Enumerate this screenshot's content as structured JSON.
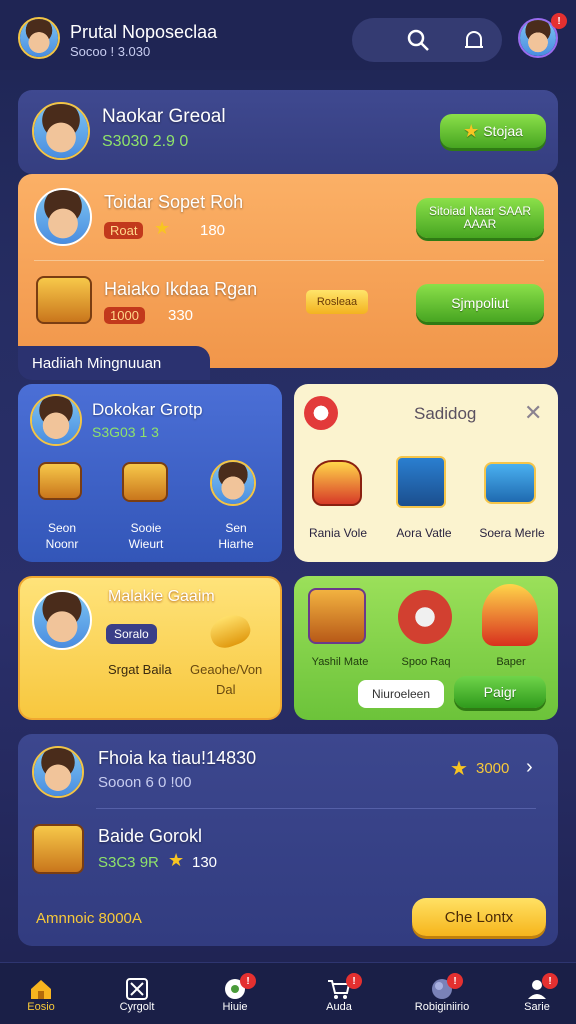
{
  "header": {
    "title": "Prutal Noposeclaa",
    "subtitle": "Socoo ! 3.030"
  },
  "profile_card": {
    "name": "Naokar Greoal",
    "stats": "S3030 2.9 0",
    "button": "Stojaa"
  },
  "orange_panel": {
    "row1": {
      "title": "Toidar Sopet Roh",
      "tag": "Roat",
      "value": "180",
      "button": "Sitoiad Naar SAAR AAAR"
    },
    "row2": {
      "title": "Haiako Ikdaa Rgan",
      "tag": "1000",
      "value": "330",
      "badge": "Rosleaa",
      "button": "Sjmpoliut"
    },
    "section_label": "Hadiiah Mingnuuan"
  },
  "blue_card": {
    "title": "Dokokar Grotp",
    "stats": "S3G03 1 3",
    "items": [
      {
        "line1": "Seon",
        "line2": "Noonr"
      },
      {
        "line1": "Sooie",
        "line2": "Wieurt"
      },
      {
        "line1": "Sen",
        "line2": "Hiarhe"
      }
    ]
  },
  "cream_card": {
    "title": "Sadidog",
    "items": [
      {
        "label": "Rania Vole"
      },
      {
        "label": "Aora Vatle"
      },
      {
        "label": "Soera Merle"
      }
    ]
  },
  "yellow_card": {
    "title": "Malakie Gaaim",
    "pill": "Soralo",
    "line1": "Srgat Baila",
    "line2a": "Geaohe/Von",
    "line2b": "Dal"
  },
  "green_card": {
    "items": [
      {
        "label": "Yashil Mate"
      },
      {
        "label": "Spoo Raq"
      },
      {
        "label": "Baper"
      }
    ],
    "button_secondary": "Niuroeleen",
    "button_primary": "Paigr"
  },
  "bottom_card": {
    "row1": {
      "title": "Fhoia ka tiau!14830",
      "sub": "Sooon 6 0 !00",
      "amount": "3000"
    },
    "row2": {
      "title": "Baide Gorokl",
      "sub": "S3C3 9R",
      "value": "130"
    },
    "footer_label": "Amnnoic 8000A",
    "footer_button": "Che Lontx"
  },
  "bottom_nav": [
    {
      "label": "Eosio",
      "icon": "home-icon"
    },
    {
      "label": "Cyrgolt",
      "icon": "crossed-square-icon"
    },
    {
      "label": "Hiuie",
      "icon": "ball-icon"
    },
    {
      "label": "Auda",
      "icon": "cart-icon"
    },
    {
      "label": "Robiginiirio",
      "icon": "globe-icon"
    },
    {
      "label": "Sarie",
      "icon": "user-icon"
    }
  ],
  "colors": {
    "accent_green": "#47a521",
    "accent_orange": "#f5a04a",
    "accent_yellow": "#f6b51c",
    "nav_bg": "#1a1f47"
  }
}
